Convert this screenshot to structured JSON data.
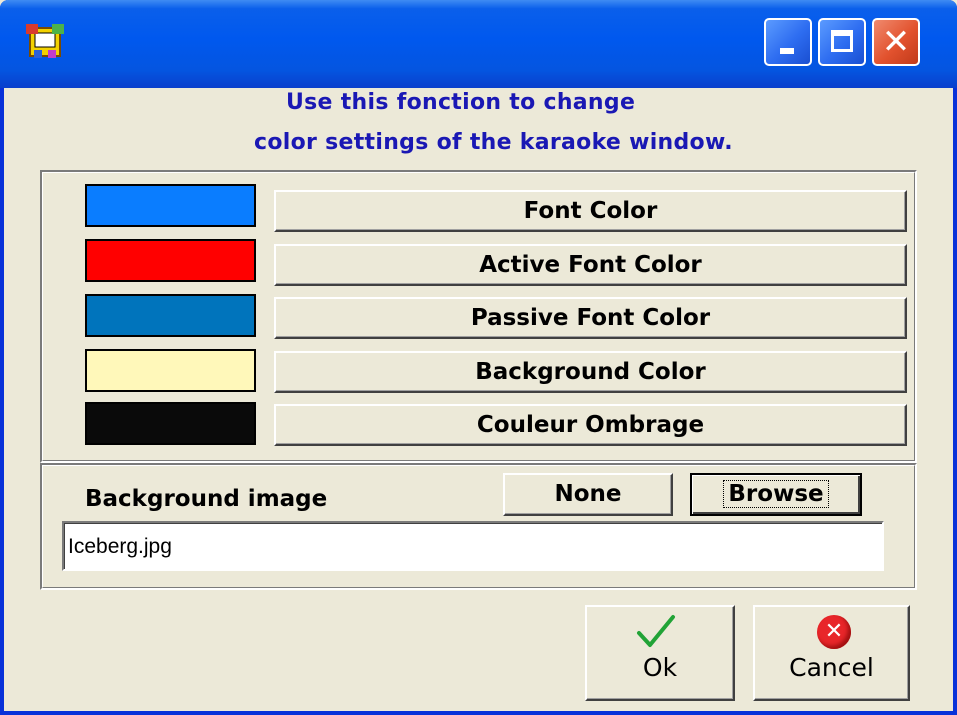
{
  "window": {
    "title": "",
    "icons": {
      "app": "karaoke-app-icon",
      "minimize": "minimize-icon",
      "maximize": "maximize-icon",
      "close": "close-icon"
    },
    "close_glyph": "✕"
  },
  "instructions": {
    "line1": "Use this fonction to change",
    "line2": "color settings of the karaoke window."
  },
  "color_settings": [
    {
      "label": "Font Color",
      "color": "#0A7DFF"
    },
    {
      "label": "Active Font Color",
      "color": "#FF0000"
    },
    {
      "label": "Passive Font Color",
      "color": "#0074BC"
    },
    {
      "label": "Background Color",
      "color": "#FFF8BA"
    },
    {
      "label": "Couleur Ombrage",
      "color": "#0A0A0A"
    }
  ],
  "background_image": {
    "label": "Background image",
    "none_label": "None",
    "browse_label": "Browse",
    "value": "Iceberg.jpg"
  },
  "actions": {
    "ok_label": "Ok",
    "cancel_label": "Cancel",
    "ok_icon": "checkmark-icon",
    "cancel_icon": "error-x-icon",
    "cancel_glyph": "✕"
  },
  "colors": {
    "title_bar": "#0058EE",
    "instruction_text": "#1A18B4",
    "dialog_bg": "#ECE9D8"
  }
}
